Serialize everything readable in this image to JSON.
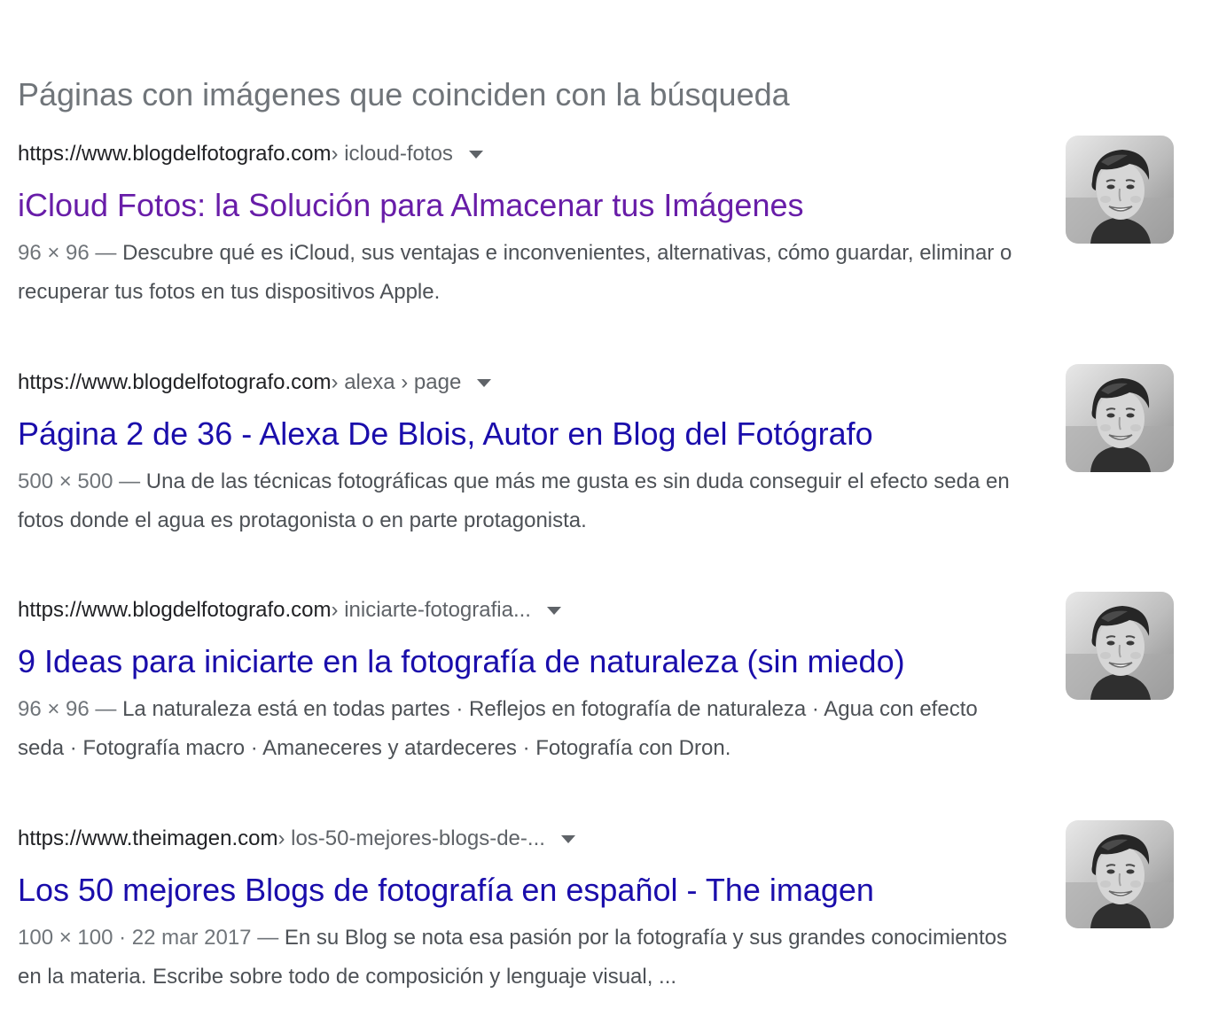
{
  "heading": "Páginas con imágenes que coinciden con la búsqueda",
  "colors": {
    "visited_link": "#681da8",
    "link": "#1a0dab",
    "heading": "#70757a",
    "snippet": "#4d5156"
  },
  "results": [
    {
      "domain": "https://www.blogdelfotografo.com",
      "path": " › icloud-fotos",
      "title": "iCloud Fotos: la Solución para Almacenar tus Imágenes",
      "visited": true,
      "meta": "96 × 96 — ",
      "snippet": "Descubre qué es iCloud, sus ventajas e inconvenientes, alternativas, cómo guardar, eliminar o recuperar tus fotos en tus dispositivos Apple.",
      "thumb_icon": "portrait-thumbnail"
    },
    {
      "domain": "https://www.blogdelfotografo.com",
      "path": " › alexa › page",
      "title": "Página 2 de 36 - Alexa De Blois, Autor en Blog del Fotógrafo",
      "visited": false,
      "meta": "500 × 500 — ",
      "snippet": "Una de las técnicas fotográficas que más me gusta es sin duda conseguir el efecto seda en fotos donde el agua es protagonista o en parte protagonista.",
      "thumb_icon": "portrait-thumbnail"
    },
    {
      "domain": "https://www.blogdelfotografo.com",
      "path": " › iniciarte-fotografia...",
      "title": "9 Ideas para iniciarte en la fotografía de naturaleza (sin miedo)",
      "visited": false,
      "meta": "96 × 96 — ",
      "snippet": "La naturaleza está en todas partes · Reflejos en fotografía de naturaleza · Agua con efecto seda · Fotografía macro · Amaneceres y atardeceres · Fotografía con Dron.",
      "thumb_icon": "portrait-thumbnail"
    },
    {
      "domain": "https://www.theimagen.com",
      "path": " › los-50-mejores-blogs-de-...",
      "title": "Los 50 mejores Blogs de fotografía en español - The imagen",
      "visited": false,
      "meta": "100 × 100 · 22 mar 2017 — ",
      "snippet": "En su Blog se nota esa pasión por la fotografía y sus grandes conocimientos en la materia. Escribe sobre todo de composición y lenguaje visual, ...",
      "thumb_icon": "portrait-thumbnail"
    }
  ]
}
